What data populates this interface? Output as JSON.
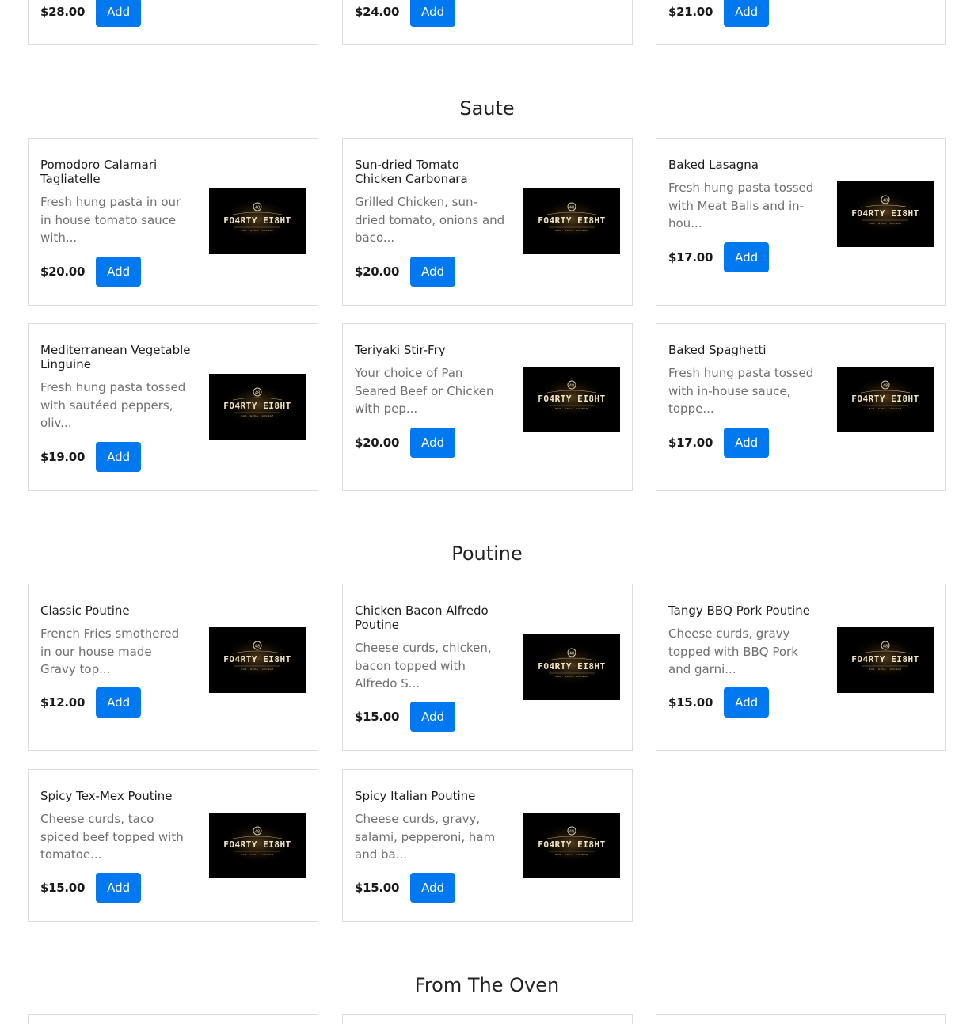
{
  "top_row": [
    {
      "price": "$28.00",
      "add_label": "Add"
    },
    {
      "price": "$24.00",
      "add_label": "Add"
    },
    {
      "price": "$21.00",
      "add_label": "Add"
    }
  ],
  "sections": [
    {
      "title": "Saute",
      "items": [
        {
          "name": "Pomodoro Calamari Tagliatelle",
          "desc": "Fresh hung pasta in our in house tomato sauce with...",
          "price": "$20.00",
          "add_label": "Add"
        },
        {
          "name": "Sun-dried Tomato Chicken Carbonara",
          "desc": "Grilled Chicken, sun-dried tomato, onions and baco...",
          "price": "$20.00",
          "add_label": "Add"
        },
        {
          "name": "Baked Lasagna",
          "desc": "Fresh hung pasta tossed with Meat Balls and in-hou...",
          "price": "$17.00",
          "add_label": "Add"
        },
        {
          "name": "Mediterranean Vegetable Linguine",
          "desc": "Fresh hung pasta tossed with sautéed peppers, oliv...",
          "price": "$19.00",
          "add_label": "Add"
        },
        {
          "name": "Teriyaki Stir-Fry",
          "desc": "Your choice of Pan Seared Beef or Chicken with pep...",
          "price": "$20.00",
          "add_label": "Add"
        },
        {
          "name": "Baked Spaghetti",
          "desc": "Fresh hung pasta tossed with in-house sauce, toppe...",
          "price": "$17.00",
          "add_label": "Add"
        }
      ]
    },
    {
      "title": "Poutine",
      "items": [
        {
          "name": "Classic Poutine",
          "desc": "French Fries smothered in our house made Gravy top...",
          "price": "$12.00",
          "add_label": "Add"
        },
        {
          "name": "Chicken Bacon Alfredo Poutine",
          "desc": "Cheese curds, chicken, bacon topped with Alfredo S...",
          "price": "$15.00",
          "add_label": "Add"
        },
        {
          "name": "Tangy BBQ Pork Poutine",
          "desc": "Cheese curds, gravy topped with BBQ Pork and garni...",
          "price": "$15.00",
          "add_label": "Add"
        },
        {
          "name": "Spicy Tex-Mex Poutine",
          "desc": "Cheese curds, taco spiced beef topped with tomatoe...",
          "price": "$15.00",
          "add_label": "Add"
        },
        {
          "name": "Spicy Italian Poutine",
          "desc": "Cheese curds, gravy, salami, pepperoni, ham and ba...",
          "price": "$15.00",
          "add_label": "Add"
        }
      ]
    },
    {
      "title": "From The Oven",
      "items": []
    }
  ],
  "logo": {
    "text": "FO4RTY EI8HT",
    "subtext": "BAR · GRILL · LOUNGE",
    "icon": "restaurant-logo-icon"
  },
  "colors": {
    "accent": "#0078f0",
    "border": "#dcdcdc",
    "muted_text": "#6f6f6f"
  }
}
